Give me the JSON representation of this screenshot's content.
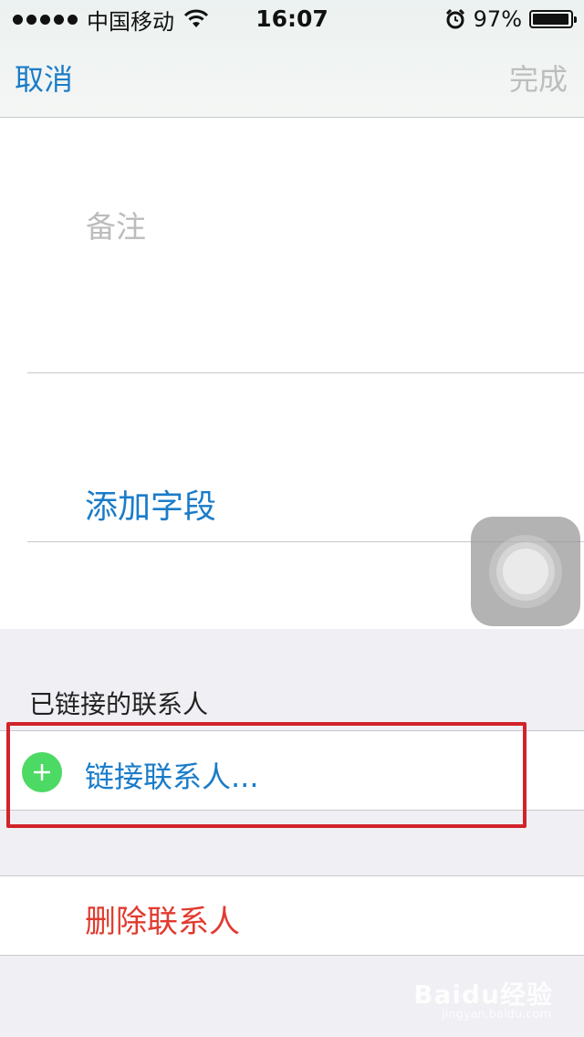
{
  "status_bar": {
    "carrier": "中国移动",
    "time": "16:07",
    "battery_percent": "97%",
    "battery_level": 0.97,
    "icons": [
      "signal-dots-icon",
      "wifi-icon",
      "alarm-icon",
      "battery-icon"
    ]
  },
  "nav": {
    "cancel_label": "取消",
    "done_label": "完成"
  },
  "form": {
    "notes_placeholder": "备注",
    "add_field_label": "添加字段"
  },
  "linked_contacts": {
    "section_title": "已链接的联系人",
    "link_label": "链接联系人..."
  },
  "delete_contact_label": "删除联系人",
  "watermark": {
    "text": "Baidu经验",
    "sub": "jingyan.baidu.com"
  },
  "colors": {
    "accent_blue": "#1a7cc9",
    "destructive_red": "#e23a2f",
    "add_green": "#4cd964",
    "highlight_red": "#d2232a",
    "disabled_gray": "#bdbdbd"
  }
}
